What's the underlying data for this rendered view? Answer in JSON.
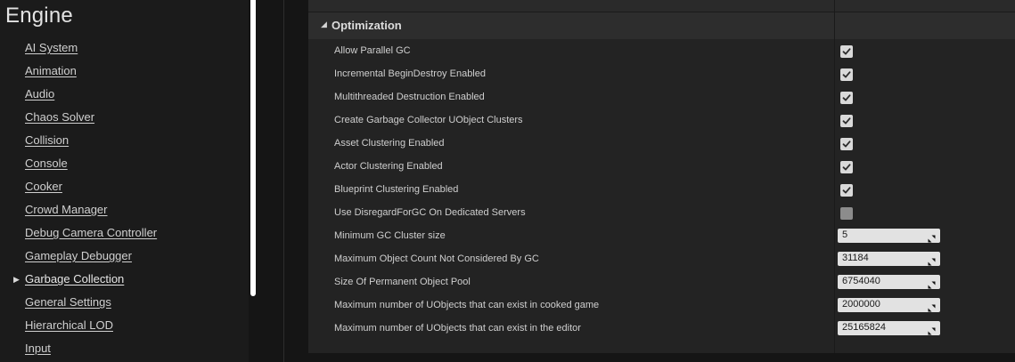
{
  "sidebar": {
    "title": "Engine",
    "items": [
      {
        "label": "AI System"
      },
      {
        "label": "Animation"
      },
      {
        "label": "Audio"
      },
      {
        "label": "Chaos Solver"
      },
      {
        "label": "Collision"
      },
      {
        "label": "Console"
      },
      {
        "label": "Cooker"
      },
      {
        "label": "Crowd Manager"
      },
      {
        "label": "Debug Camera Controller"
      },
      {
        "label": "Gameplay Debugger"
      },
      {
        "label": "Garbage Collection"
      },
      {
        "label": "General Settings"
      },
      {
        "label": "Hierarchical LOD"
      },
      {
        "label": "Input"
      }
    ],
    "active_item": "Garbage Collection"
  },
  "section": {
    "title": "Optimization",
    "expander_icon": "triangle-down-icon"
  },
  "settings": [
    {
      "label": "Allow Parallel GC",
      "type": "checkbox",
      "checked": true
    },
    {
      "label": "Incremental BeginDestroy Enabled",
      "type": "checkbox",
      "checked": true
    },
    {
      "label": "Multithreaded Destruction Enabled",
      "type": "checkbox",
      "checked": true
    },
    {
      "label": "Create Garbage Collector UObject Clusters",
      "type": "checkbox",
      "checked": true
    },
    {
      "label": "Asset Clustering Enabled",
      "type": "checkbox",
      "checked": true
    },
    {
      "label": "Actor Clustering Enabled",
      "type": "checkbox",
      "checked": true
    },
    {
      "label": "Blueprint Clustering Enabled",
      "type": "checkbox",
      "checked": true
    },
    {
      "label": "Use DisregardForGC On Dedicated Servers",
      "type": "checkbox",
      "checked": false
    },
    {
      "label": "Minimum GC Cluster size",
      "type": "number",
      "value": "5"
    },
    {
      "label": "Maximum Object Count Not Considered By GC",
      "type": "number",
      "value": "31184"
    },
    {
      "label": "Size Of Permanent Object Pool",
      "type": "number",
      "value": "6754040"
    },
    {
      "label": "Maximum number of UObjects that can exist in cooked game",
      "type": "number",
      "value": "2000000"
    },
    {
      "label": "Maximum number of UObjects that can exist in the editor",
      "type": "number",
      "value": "25165824"
    }
  ],
  "colors": {
    "background": "#151515",
    "sidebar": "#1b1b1b",
    "panel": "#232323",
    "section_header": "#2d2d2d",
    "checkbox_on": "#d9d9d9",
    "checkbox_off": "#8c8c8c",
    "input_field": "#e2e2e2"
  }
}
